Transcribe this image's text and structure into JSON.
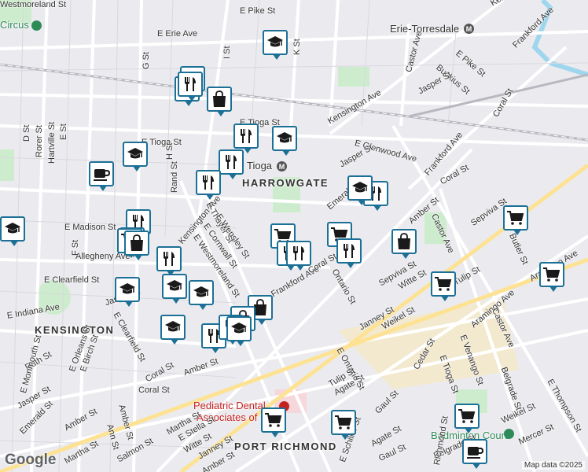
{
  "map": {
    "attribution": "Map data ©2025",
    "logo": "Google",
    "neighborhoods": [
      {
        "name": "HARROWGATE"
      },
      {
        "name": "KENSINGTON"
      },
      {
        "name": "PORT RICHMOND"
      }
    ],
    "pois": [
      {
        "name": "Circus",
        "color": "#2e8b57"
      },
      {
        "name": "Erie-Torresdale",
        "color": "#333333"
      },
      {
        "name": "Tioga",
        "color": "#333333"
      },
      {
        "name": "Pediatric Dental",
        "color": "#c5221f"
      },
      {
        "name": "Associates of",
        "color": "#c5221f"
      },
      {
        "name": "Badminton Court",
        "color": "#2e8b57"
      }
    ],
    "streets": [
      "E Pike St",
      "E Erie Ave",
      "Kensington Ave",
      "Frankford Ave",
      "L St",
      "K St",
      "I St",
      "G St",
      "Palmetto St",
      "Castor Ave",
      "Buckius St",
      "E Pike St",
      "Jasper St",
      "Kensington Ave",
      "E Tioga St",
      "E Tioga St",
      "Coral St",
      "D St",
      "Rorer St",
      "Hartville St",
      "E St",
      "H St",
      "E Glenwood Ave",
      "Jasper St",
      "Frankford Ave",
      "Coral St",
      "Rand St",
      "Kensington Ave",
      "E Thayer St",
      "E Wensley St",
      "E Cornwall St",
      "E Westmoreland St",
      "Emerald St",
      "Amber St",
      "Castor Ave",
      "Sepviva St",
      "Butler St",
      "Aramingo Ave",
      "E Madison St",
      "Allegheny Ave",
      "F St",
      "E Clearfield St",
      "Jasper St",
      "Coral St",
      "Frankford Ave",
      "Coral St",
      "Ontario St",
      "Sepviva St",
      "Witte St",
      "Tulip St",
      "E Indiana Ave",
      "E Clearfield St",
      "Janney St",
      "Weikel St",
      "Aramingo Ave",
      "Castor Ave",
      "Ruth St",
      "E Monmouth St",
      "E Orleans St",
      "E Birch St",
      "E Ontario St",
      "Gaul St",
      "Cedar St",
      "E Venango St",
      "Belgrade St",
      "E Thompson St",
      "Jasper St",
      "Coral St",
      "Amber St",
      "Tulip St",
      "Agate St",
      "E Tioga St",
      "Emerald St",
      "Amber St",
      "Martha St",
      "Amber St",
      "Ann St",
      "E Stella St",
      "Witte St",
      "Janney St",
      "Weikel St",
      "Mercer St",
      "Salmon St",
      "Martha St",
      "Amber St",
      "Agate St",
      "Gaul St",
      "Belgrade St",
      "Richmond St",
      "E Schiller St",
      "Westmoreland St"
    ],
    "markers": [
      {
        "type": "school"
      },
      {
        "type": "restaurant"
      },
      {
        "type": "cafe"
      },
      {
        "type": "shopping"
      },
      {
        "type": "restaurant"
      },
      {
        "type": "school"
      },
      {
        "type": "school"
      },
      {
        "type": "cafe"
      },
      {
        "type": "restaurant"
      },
      {
        "type": "restaurant"
      },
      {
        "type": "restaurant"
      },
      {
        "type": "grocery"
      },
      {
        "type": "grocery"
      },
      {
        "type": "restaurant"
      },
      {
        "type": "restaurant"
      },
      {
        "type": "grocery"
      },
      {
        "type": "shopping"
      },
      {
        "type": "grocery"
      },
      {
        "type": "school"
      },
      {
        "type": "restaurant"
      },
      {
        "type": "shopping"
      },
      {
        "type": "grocery"
      },
      {
        "type": "grocery"
      },
      {
        "type": "school"
      },
      {
        "type": "school"
      },
      {
        "type": "school"
      },
      {
        "type": "restaurant"
      },
      {
        "type": "school"
      },
      {
        "type": "restaurant"
      },
      {
        "type": "restaurant"
      },
      {
        "type": "shopping"
      },
      {
        "type": "shopping"
      },
      {
        "type": "restaurant"
      },
      {
        "type": "shopping"
      },
      {
        "type": "school"
      },
      {
        "type": "grocery"
      },
      {
        "type": "grocery"
      },
      {
        "type": "grocery"
      },
      {
        "type": "cafe"
      },
      {
        "type": "restaurant"
      },
      {
        "type": "school"
      }
    ]
  }
}
